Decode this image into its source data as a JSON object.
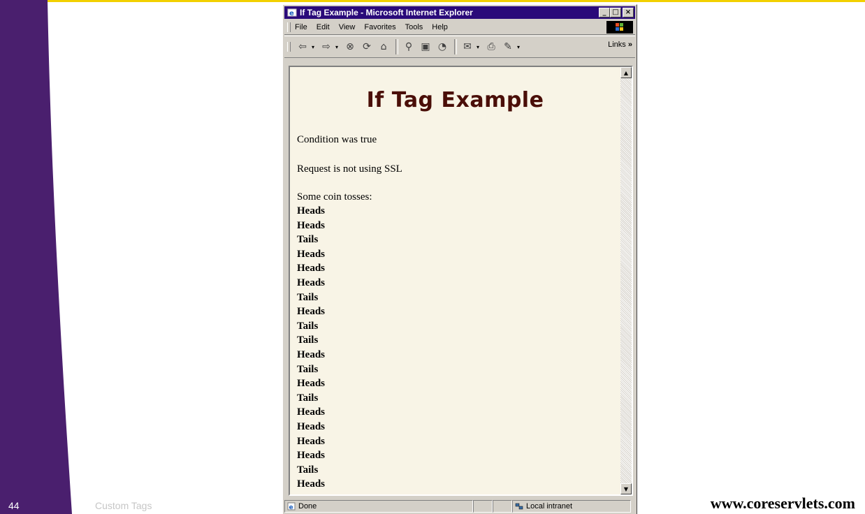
{
  "slide": {
    "page_number": "44",
    "footer_label": "Custom Tags",
    "url": "www.coreservlets.com"
  },
  "window": {
    "title": "If Tag Example - Microsoft Internet Explorer",
    "menu": [
      {
        "label": "File",
        "key": "F"
      },
      {
        "label": "Edit",
        "key": "E"
      },
      {
        "label": "View",
        "key": "V"
      },
      {
        "label": "Favorites",
        "key": "a"
      },
      {
        "label": "Tools",
        "key": "T"
      },
      {
        "label": "Help",
        "key": "H"
      }
    ],
    "toolbar_links_label": "Links",
    "status_text": "Done",
    "zone_text": "Local intranet"
  },
  "page": {
    "heading": "If Tag Example",
    "condition_text": "Condition was true",
    "ssl_text": "Request is not using SSL",
    "coin_intro": "Some coin tosses:",
    "coin_tosses": [
      "Heads",
      "Heads",
      "Tails",
      "Heads",
      "Heads",
      "Heads",
      "Tails",
      "Heads",
      "Tails",
      "Tails",
      "Heads",
      "Tails",
      "Heads",
      "Tails",
      "Heads",
      "Heads",
      "Heads",
      "Heads",
      "Tails",
      "Heads"
    ]
  },
  "colors": {
    "slide_purple": "#4a1f6e",
    "slide_accent": "#f2d000",
    "title_bar": "#2a0a7a",
    "page_background": "#f8f4e6",
    "heading_color": "#4a0e08"
  }
}
